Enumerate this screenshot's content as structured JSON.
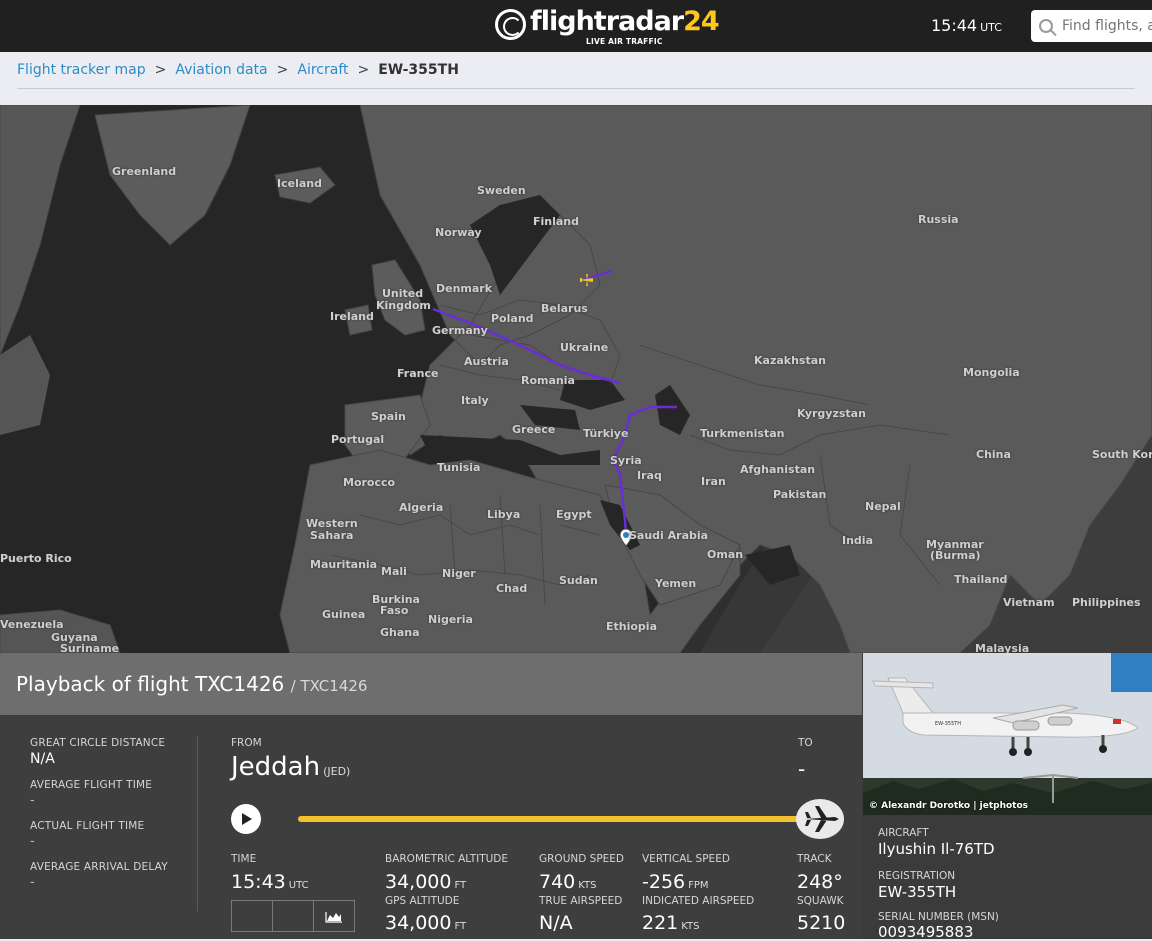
{
  "header": {
    "logo_text_main": "flightradar",
    "logo_text_accent": "24",
    "logo_tagline": "LIVE AIR TRAFFIC",
    "time": "15:44",
    "time_zone": "UTC",
    "search_placeholder": "Find flights, ai"
  },
  "breadcrumb": {
    "items": [
      "Flight tracker map",
      "Aviation data",
      "Aircraft"
    ],
    "separator": ">",
    "current": "EW-355TH"
  },
  "map": {
    "labels": [
      {
        "text": "Greenland"
      },
      {
        "text": "Iceland"
      },
      {
        "text": "Sweden"
      },
      {
        "text": "Finland"
      },
      {
        "text": "Norway"
      },
      {
        "text": "Russia"
      },
      {
        "text": "Denmark"
      },
      {
        "text": "United"
      },
      {
        "text": "Kingdom"
      },
      {
        "text": "Belarus"
      },
      {
        "text": "Ireland"
      },
      {
        "text": "Poland"
      },
      {
        "text": "Germany"
      },
      {
        "text": "Ukraine"
      },
      {
        "text": "Kazakhstan"
      },
      {
        "text": "Austria"
      },
      {
        "text": "France"
      },
      {
        "text": "Romania"
      },
      {
        "text": "Mongolia"
      },
      {
        "text": "Spain"
      },
      {
        "text": "Italy"
      },
      {
        "text": "Kyrgyzstan"
      },
      {
        "text": "Portugal"
      },
      {
        "text": "Greece"
      },
      {
        "text": "Türkiye"
      },
      {
        "text": "Turkmenistan"
      },
      {
        "text": "Tunisia"
      },
      {
        "text": "China"
      },
      {
        "text": "South Kore"
      },
      {
        "text": "Syria"
      },
      {
        "text": "Iraq"
      },
      {
        "text": "Afghanistan"
      },
      {
        "text": "Morocco"
      },
      {
        "text": "Iran"
      },
      {
        "text": "Algeria"
      },
      {
        "text": "Libya"
      },
      {
        "text": "Egypt"
      },
      {
        "text": "Pakistan"
      },
      {
        "text": "Western"
      },
      {
        "text": "Sahara"
      },
      {
        "text": "Saudi Arabia"
      },
      {
        "text": "Nepal"
      },
      {
        "text": "India"
      },
      {
        "text": "Myanmar"
      },
      {
        "text": "(Burma)"
      },
      {
        "text": "Puerto Rico"
      },
      {
        "text": "Oman"
      },
      {
        "text": "Mauritania"
      },
      {
        "text": "Mali"
      },
      {
        "text": "Niger"
      },
      {
        "text": "Chad"
      },
      {
        "text": "Sudan"
      },
      {
        "text": "Yemen"
      },
      {
        "text": "Thailand"
      },
      {
        "text": "Burkina"
      },
      {
        "text": "Faso"
      },
      {
        "text": "Guinea"
      },
      {
        "text": "Nigeria"
      },
      {
        "text": "Vietnam"
      },
      {
        "text": "Philippines"
      },
      {
        "text": "Venezuela"
      },
      {
        "text": "Ghana"
      },
      {
        "text": "Ethiopia"
      },
      {
        "text": "Guyana"
      },
      {
        "text": "Suriname"
      },
      {
        "text": "Malaysia"
      }
    ]
  },
  "flight": {
    "title": "Playback of flight TXC1426",
    "callsign": "/ TXC1426",
    "stats": [
      {
        "label": "GREAT CIRCLE DISTANCE",
        "value": "N/A"
      },
      {
        "label": "AVERAGE FLIGHT TIME",
        "value": "-"
      },
      {
        "label": "ACTUAL FLIGHT TIME",
        "value": "-"
      },
      {
        "label": "AVERAGE ARRIVAL DELAY",
        "value": "-"
      }
    ],
    "from_label": "FROM",
    "from_city": "Jeddah",
    "from_code": "(JED)",
    "to_label": "TO",
    "to_city": "-",
    "progress": 1.0,
    "time_label": "TIME",
    "time_value": "15:43",
    "time_unit": "UTC",
    "baro_alt_label": "BAROMETRIC ALTITUDE",
    "baro_alt_value": "34,000",
    "baro_alt_unit": "FT",
    "gps_alt_label": "GPS ALTITUDE",
    "gps_alt_value": "34,000",
    "gps_alt_unit": "FT",
    "ground_speed_label": "GROUND SPEED",
    "ground_speed_value": "740",
    "ground_speed_unit": "KTS",
    "true_airspeed_label": "TRUE AIRSPEED",
    "true_airspeed_value": "N/A",
    "vertical_speed_label": "VERTICAL SPEED",
    "vertical_speed_value": "-256",
    "vertical_speed_unit": "FPM",
    "indicated_airspeed_label": "INDICATED AIRSPEED",
    "indicated_airspeed_value": "221",
    "indicated_airspeed_unit": "KTS",
    "track_label": "TRACK",
    "track_value": "248°",
    "squawk_label": "SQUAWK",
    "squawk_value": "5210"
  },
  "aircraft": {
    "photo_credit": "© Alexandr Dorotko | jetphotos",
    "aircraft_label": "AIRCRAFT",
    "aircraft_value": "Ilyushin Il-76TD",
    "registration_label": "REGISTRATION",
    "registration_value": "EW-355TH",
    "serial_label": "SERIAL NUMBER (MSN)",
    "serial_value": "0093495883"
  },
  "colors": {
    "route": "#6a2dd8",
    "progress": "#f2c12e",
    "accent_blue": "#2e7fc3",
    "header_bg": "#202021"
  }
}
